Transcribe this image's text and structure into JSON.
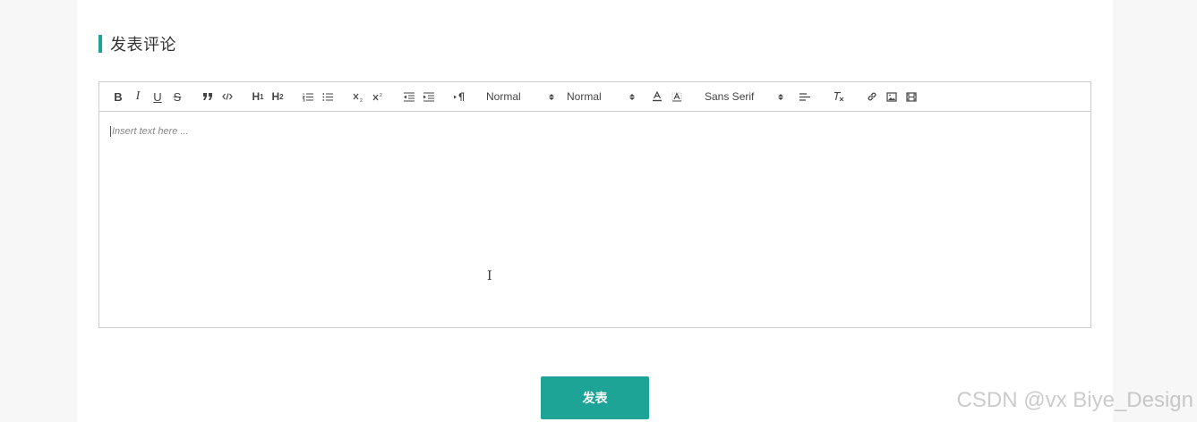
{
  "section": {
    "title": "发表评论"
  },
  "toolbar": {
    "bold_label": "B",
    "italic_label": "I",
    "underline_label": "U",
    "strike_label": "S",
    "h1_label": "H",
    "h1_sub": "1",
    "h2_label": "H",
    "h2_sub": "2",
    "header_picker": "Normal",
    "size_picker": "Normal",
    "font_picker": "Sans Serif"
  },
  "editor": {
    "placeholder": "Insert text here ..."
  },
  "actions": {
    "submit_label": "发表"
  },
  "watermark": {
    "text": "CSDN @vx Biye_Design"
  },
  "colors": {
    "accent": "#1ea397",
    "border": "#cccccc",
    "page_bg": "#f7f7f7"
  },
  "icons": {
    "blockquote": "quote-icon",
    "code": "code-icon",
    "ordered_list": "ordered-list-icon",
    "bullet_list": "bullet-list-icon",
    "subscript": "subscript-icon",
    "superscript": "superscript-icon",
    "outdent": "outdent-icon",
    "indent": "indent-icon",
    "direction": "text-direction-icon",
    "text_color": "text-color-icon",
    "background_color": "background-color-icon",
    "align": "align-left-icon",
    "clean": "clear-format-icon",
    "link": "link-icon",
    "image": "image-icon",
    "video": "video-icon"
  }
}
